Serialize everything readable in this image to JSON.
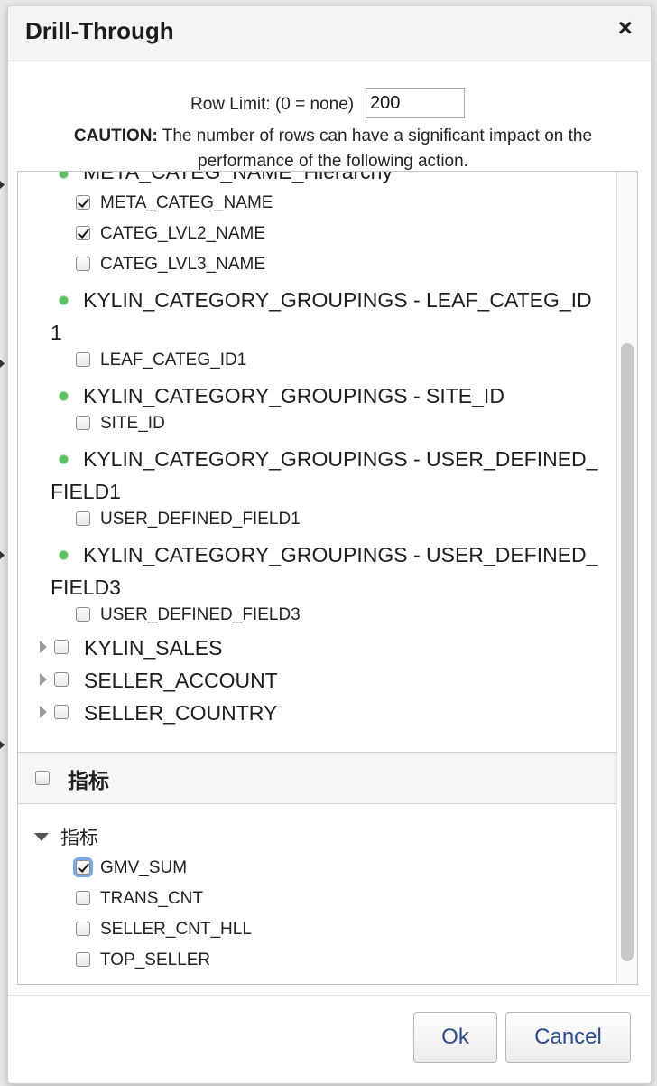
{
  "dialog": {
    "title": "Drill-Through",
    "close_glyph": "×"
  },
  "row_limit": {
    "label": "Row Limit: (0 = none)",
    "value": "200"
  },
  "caution": {
    "bold": "CAUTION:",
    "text": " The number of rows can have a significant impact on the performance of the following action."
  },
  "tree": {
    "partial_group": "META_CATEG_NAME_Hierarchy",
    "items": {
      "meta_categ_name": "META_CATEG_NAME",
      "categ_lvl2_name": "CATEG_LVL2_NAME",
      "categ_lvl3_name": "CATEG_LVL3_NAME",
      "group_leaf_categ_line1": "KYLIN_CATEGORY_GROUPINGS - LEAF_CATEG_ID",
      "group_leaf_categ_line2": "1",
      "leaf_categ_id1": "LEAF_CATEG_ID1",
      "group_site_id": "KYLIN_CATEGORY_GROUPINGS - SITE_ID",
      "site_id": "SITE_ID",
      "group_udf1_line1": "KYLIN_CATEGORY_GROUPINGS - USER_DEFINED_",
      "group_udf1_line2": "FIELD1",
      "user_defined_field1": "USER_DEFINED_FIELD1",
      "group_udf3_line1": "KYLIN_CATEGORY_GROUPINGS - USER_DEFINED_",
      "group_udf3_line2": "FIELD3",
      "user_defined_field3": "USER_DEFINED_FIELD3",
      "kylin_sales": "KYLIN_SALES",
      "seller_account": "SELLER_ACCOUNT",
      "seller_country": "SELLER_COUNTRY"
    },
    "checked": {
      "meta_categ_name": true,
      "categ_lvl2_name": true,
      "categ_lvl3_name": false,
      "gmv_sum": true
    }
  },
  "measures": {
    "header_label": "指标",
    "group_label": "指标",
    "items": [
      "GMV_SUM",
      "TRANS_CNT",
      "SELLER_CNT_HLL",
      "TOP_SELLER"
    ]
  },
  "footer": {
    "ok_label": "Ok",
    "cancel_label": "Cancel"
  },
  "colors": {
    "dot_green": "#5cbf62",
    "button_text": "#2a4c8c",
    "focus_ring": "#7aa7e8"
  }
}
